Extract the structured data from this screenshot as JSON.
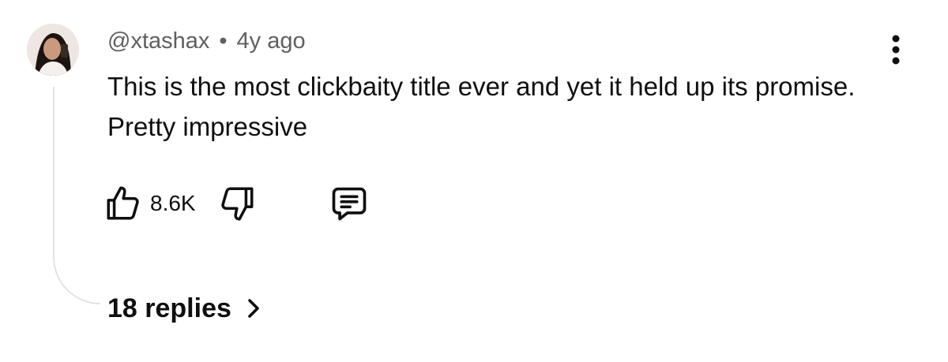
{
  "comment": {
    "author": "@xtashax",
    "separator": "•",
    "time_ago": "4y ago",
    "text": "This is the most clickbaity title ever and yet it held up its promise. Pretty impressive",
    "likes": "8.6K",
    "replies_label": "18 replies"
  },
  "icons": {
    "more": "more-vertical-icon",
    "like": "thumbs-up-icon",
    "dislike": "thumbs-down-icon",
    "reply": "comment-icon",
    "chevron": "chevron-right-icon"
  },
  "colors": {
    "text": "#0f0f0f",
    "meta": "#606060",
    "thread_line": "#e3e3e3"
  }
}
